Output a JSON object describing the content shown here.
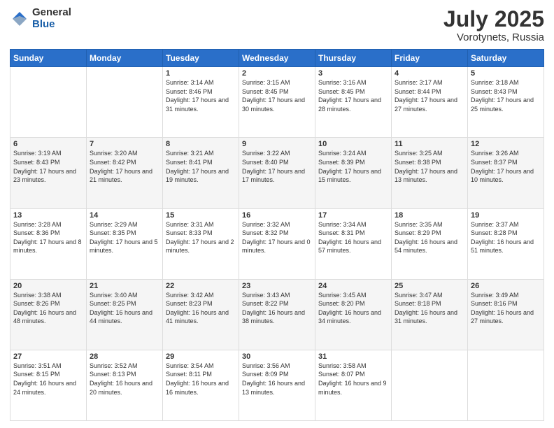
{
  "logo": {
    "general": "General",
    "blue": "Blue"
  },
  "title": "July 2025",
  "subtitle": "Vorotynets, Russia",
  "days_header": [
    "Sunday",
    "Monday",
    "Tuesday",
    "Wednesday",
    "Thursday",
    "Friday",
    "Saturday"
  ],
  "weeks": [
    [
      {
        "day": "",
        "info": ""
      },
      {
        "day": "",
        "info": ""
      },
      {
        "day": "1",
        "info": "Sunrise: 3:14 AM\nSunset: 8:46 PM\nDaylight: 17 hours and 31 minutes."
      },
      {
        "day": "2",
        "info": "Sunrise: 3:15 AM\nSunset: 8:45 PM\nDaylight: 17 hours and 30 minutes."
      },
      {
        "day": "3",
        "info": "Sunrise: 3:16 AM\nSunset: 8:45 PM\nDaylight: 17 hours and 28 minutes."
      },
      {
        "day": "4",
        "info": "Sunrise: 3:17 AM\nSunset: 8:44 PM\nDaylight: 17 hours and 27 minutes."
      },
      {
        "day": "5",
        "info": "Sunrise: 3:18 AM\nSunset: 8:43 PM\nDaylight: 17 hours and 25 minutes."
      }
    ],
    [
      {
        "day": "6",
        "info": "Sunrise: 3:19 AM\nSunset: 8:43 PM\nDaylight: 17 hours and 23 minutes."
      },
      {
        "day": "7",
        "info": "Sunrise: 3:20 AM\nSunset: 8:42 PM\nDaylight: 17 hours and 21 minutes."
      },
      {
        "day": "8",
        "info": "Sunrise: 3:21 AM\nSunset: 8:41 PM\nDaylight: 17 hours and 19 minutes."
      },
      {
        "day": "9",
        "info": "Sunrise: 3:22 AM\nSunset: 8:40 PM\nDaylight: 17 hours and 17 minutes."
      },
      {
        "day": "10",
        "info": "Sunrise: 3:24 AM\nSunset: 8:39 PM\nDaylight: 17 hours and 15 minutes."
      },
      {
        "day": "11",
        "info": "Sunrise: 3:25 AM\nSunset: 8:38 PM\nDaylight: 17 hours and 13 minutes."
      },
      {
        "day": "12",
        "info": "Sunrise: 3:26 AM\nSunset: 8:37 PM\nDaylight: 17 hours and 10 minutes."
      }
    ],
    [
      {
        "day": "13",
        "info": "Sunrise: 3:28 AM\nSunset: 8:36 PM\nDaylight: 17 hours and 8 minutes."
      },
      {
        "day": "14",
        "info": "Sunrise: 3:29 AM\nSunset: 8:35 PM\nDaylight: 17 hours and 5 minutes."
      },
      {
        "day": "15",
        "info": "Sunrise: 3:31 AM\nSunset: 8:33 PM\nDaylight: 17 hours and 2 minutes."
      },
      {
        "day": "16",
        "info": "Sunrise: 3:32 AM\nSunset: 8:32 PM\nDaylight: 17 hours and 0 minutes."
      },
      {
        "day": "17",
        "info": "Sunrise: 3:34 AM\nSunset: 8:31 PM\nDaylight: 16 hours and 57 minutes."
      },
      {
        "day": "18",
        "info": "Sunrise: 3:35 AM\nSunset: 8:29 PM\nDaylight: 16 hours and 54 minutes."
      },
      {
        "day": "19",
        "info": "Sunrise: 3:37 AM\nSunset: 8:28 PM\nDaylight: 16 hours and 51 minutes."
      }
    ],
    [
      {
        "day": "20",
        "info": "Sunrise: 3:38 AM\nSunset: 8:26 PM\nDaylight: 16 hours and 48 minutes."
      },
      {
        "day": "21",
        "info": "Sunrise: 3:40 AM\nSunset: 8:25 PM\nDaylight: 16 hours and 44 minutes."
      },
      {
        "day": "22",
        "info": "Sunrise: 3:42 AM\nSunset: 8:23 PM\nDaylight: 16 hours and 41 minutes."
      },
      {
        "day": "23",
        "info": "Sunrise: 3:43 AM\nSunset: 8:22 PM\nDaylight: 16 hours and 38 minutes."
      },
      {
        "day": "24",
        "info": "Sunrise: 3:45 AM\nSunset: 8:20 PM\nDaylight: 16 hours and 34 minutes."
      },
      {
        "day": "25",
        "info": "Sunrise: 3:47 AM\nSunset: 8:18 PM\nDaylight: 16 hours and 31 minutes."
      },
      {
        "day": "26",
        "info": "Sunrise: 3:49 AM\nSunset: 8:16 PM\nDaylight: 16 hours and 27 minutes."
      }
    ],
    [
      {
        "day": "27",
        "info": "Sunrise: 3:51 AM\nSunset: 8:15 PM\nDaylight: 16 hours and 24 minutes."
      },
      {
        "day": "28",
        "info": "Sunrise: 3:52 AM\nSunset: 8:13 PM\nDaylight: 16 hours and 20 minutes."
      },
      {
        "day": "29",
        "info": "Sunrise: 3:54 AM\nSunset: 8:11 PM\nDaylight: 16 hours and 16 minutes."
      },
      {
        "day": "30",
        "info": "Sunrise: 3:56 AM\nSunset: 8:09 PM\nDaylight: 16 hours and 13 minutes."
      },
      {
        "day": "31",
        "info": "Sunrise: 3:58 AM\nSunset: 8:07 PM\nDaylight: 16 hours and 9 minutes."
      },
      {
        "day": "",
        "info": ""
      },
      {
        "day": "",
        "info": ""
      }
    ]
  ]
}
